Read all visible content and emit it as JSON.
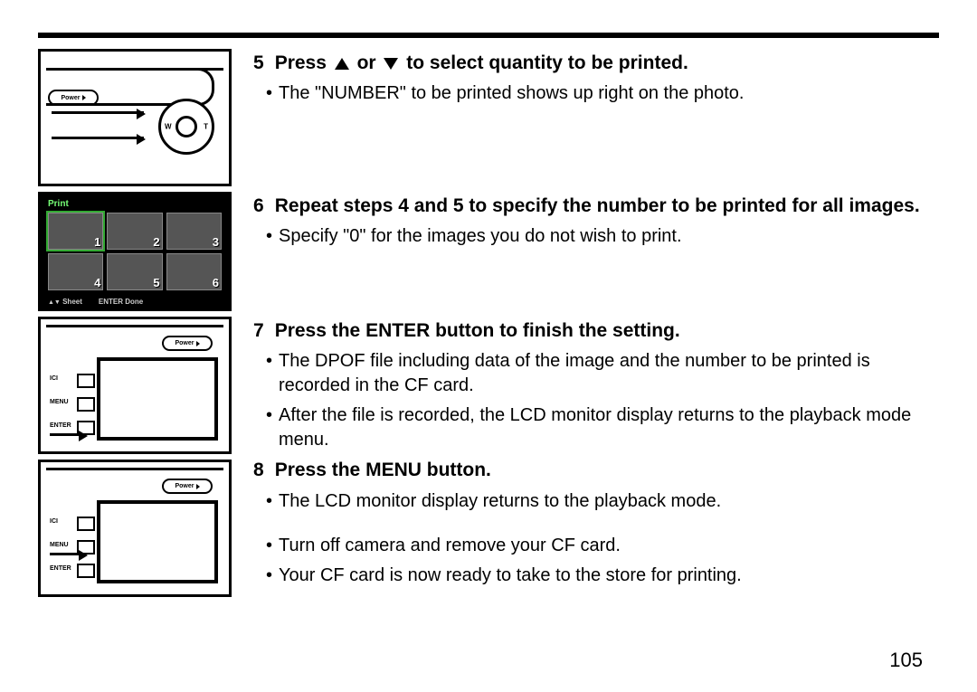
{
  "page_number": "105",
  "figure_labels": {
    "power": "Power",
    "wt_left": "W",
    "wt_right": "T",
    "print_title": "Print",
    "foot_sheet": "Sheet",
    "foot_enter": "ENTER Done",
    "side_btn1": "ICI",
    "side_btn2": "MENU",
    "side_btn3": "ENTER"
  },
  "thumbs": [
    "1",
    "2",
    "3",
    "4",
    "5",
    "6"
  ],
  "steps": [
    {
      "num": "5",
      "title_before_icons": "Press",
      "title_mid": "or",
      "title_after_icons": "to select quantity to be printed.",
      "bullets": [
        "The \"NUMBER\" to be printed shows up right on the photo."
      ]
    },
    {
      "num": "6",
      "title": "Repeat steps 4 and 5 to specify the number to be printed for all images.",
      "bullets": [
        "Specify \"0\" for the images you do not wish to print."
      ]
    },
    {
      "num": "7",
      "title": "Press the ENTER button to finish the setting.",
      "bullets": [
        "The DPOF file including data of the image and the number to be printed is recorded in the CF card.",
        "After the file is recorded, the LCD monitor display returns to the playback mode menu."
      ]
    },
    {
      "num": "8",
      "title": "Press the MENU button.",
      "bullets": [
        "The LCD monitor display returns to the playback mode.",
        "",
        "Turn off camera and remove your CF card.",
        "Your CF card is now ready to take to the store for printing."
      ]
    }
  ]
}
